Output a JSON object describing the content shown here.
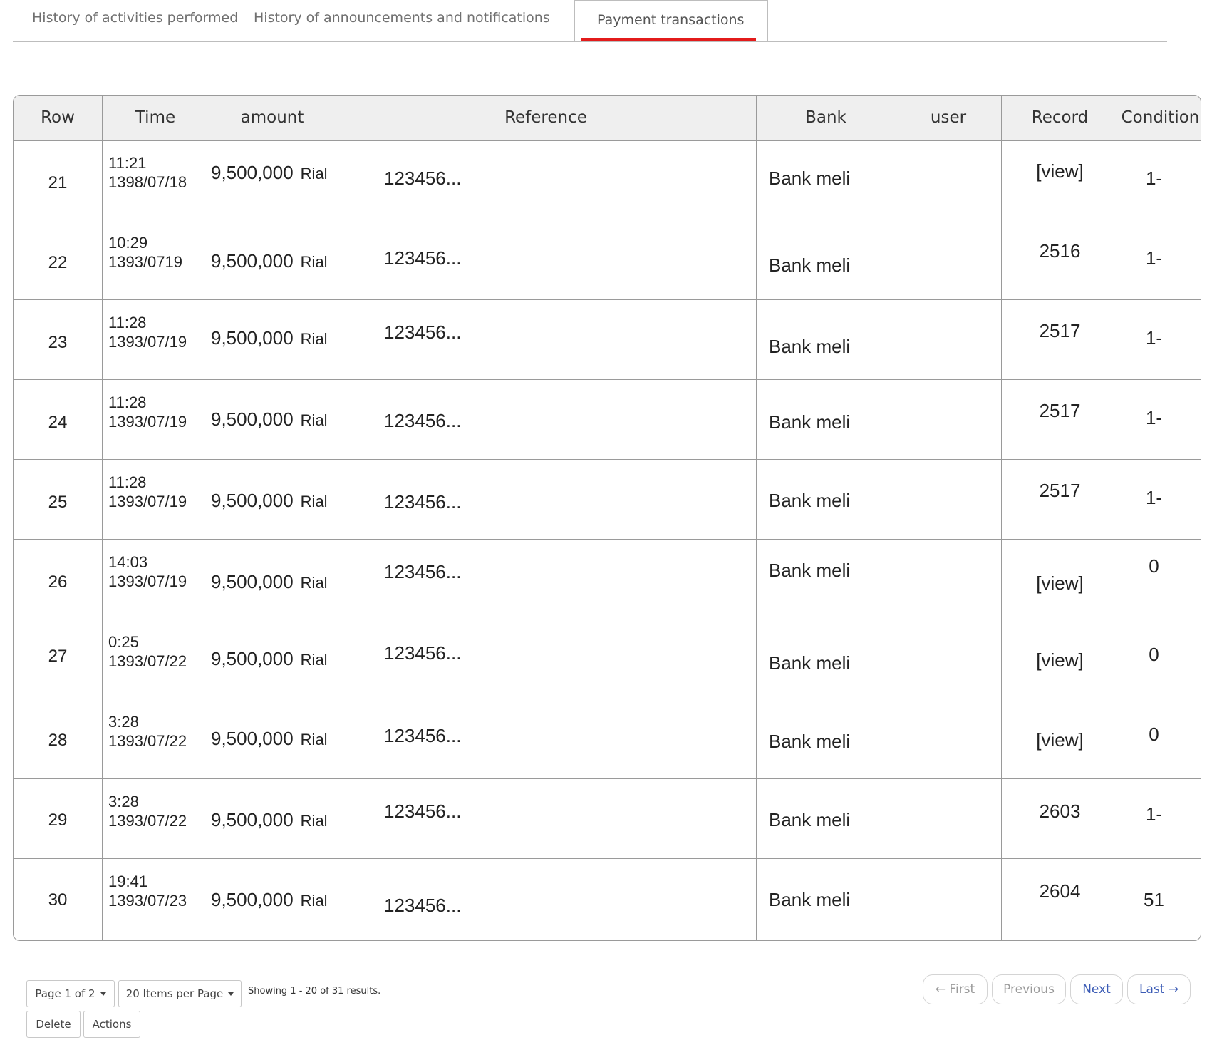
{
  "tabs": [
    {
      "label": "History of activities performed"
    },
    {
      "label": "History of announcements and notifications"
    },
    {
      "label": "Payment transactions",
      "active": true
    }
  ],
  "colors": {
    "accent": "#e31b1b",
    "link": "#3b5bb5",
    "header_bg": "#efefef",
    "border": "#9a9a9a"
  },
  "table": {
    "headers": [
      "Row",
      "Time",
      "amount",
      "Reference",
      "Bank",
      "user",
      "Record",
      "Condition"
    ],
    "rows": [
      {
        "row": "21",
        "time1": "11:21",
        "time2": "1398/07/18",
        "amount": "9,500,000",
        "unit": "Rial",
        "reference": "123456...",
        "bank": "Bank meli",
        "user": "",
        "record": "[view]",
        "condition": "1-"
      },
      {
        "row": "22",
        "time1": "10:29",
        "time2": "1393/0719",
        "amount": "9,500,000",
        "unit": "Rial",
        "reference": "123456...",
        "bank": "Bank meli",
        "user": "",
        "record": "2516",
        "condition": "1-"
      },
      {
        "row": "23",
        "time1": "11:28",
        "time2": "1393/07/19",
        "amount": "9,500,000",
        "unit": "Rial",
        "reference": "123456...",
        "bank": "Bank meli",
        "user": "",
        "record": "2517",
        "condition": "1-"
      },
      {
        "row": "24",
        "time1": "11:28",
        "time2": "1393/07/19",
        "amount": "9,500,000",
        "unit": "Rial",
        "reference": "123456...",
        "bank": "Bank meli",
        "user": "",
        "record": "2517",
        "condition": "1-"
      },
      {
        "row": "25",
        "time1": "11:28",
        "time2": "1393/07/19",
        "amount": "9,500,000",
        "unit": "Rial",
        "reference": "123456...",
        "bank": "Bank meli",
        "user": "",
        "record": "2517",
        "condition": "1-"
      },
      {
        "row": "26",
        "time1": "14:03",
        "time2": "1393/07/19",
        "amount": "9,500,000",
        "unit": "Rial",
        "reference": "123456...",
        "bank": "Bank meli",
        "user": "",
        "record": "[view]",
        "condition": "0"
      },
      {
        "row": "27",
        "time1": "0:25",
        "time2": "1393/07/22",
        "amount": "9,500,000",
        "unit": "Rial",
        "reference": "123456...",
        "bank": "Bank meli",
        "user": "",
        "record": "[view]",
        "condition": "0"
      },
      {
        "row": "28",
        "time1": "3:28",
        "time2": "1393/07/22",
        "amount": "9,500,000",
        "unit": "Rial",
        "reference": "123456...",
        "bank": "Bank meli",
        "user": "",
        "record": "[view]",
        "condition": "0"
      },
      {
        "row": "29",
        "time1": "3:28",
        "time2": "1393/07/22",
        "amount": "9,500,000",
        "unit": "Rial",
        "reference": "123456...",
        "bank": "Bank meli",
        "user": "",
        "record": "2603",
        "condition": "1-"
      },
      {
        "row": "30",
        "time1": "19:41",
        "time2": "1393/07/23",
        "amount": "9,500,000",
        "unit": "Rial",
        "reference": "123456...",
        "bank": "Bank meli",
        "user": "",
        "record": "2604",
        "condition": "51"
      }
    ]
  },
  "footer": {
    "page_select": "Page 1 of 2",
    "per_page_select": "20 Items per Page",
    "showing": "Showing 1 - 20 of 31 results.",
    "delete_label": "Delete",
    "actions_label": "Actions",
    "pagination": {
      "first": "← First",
      "previous": "Previous",
      "next": "Next",
      "last": "Last →"
    }
  }
}
